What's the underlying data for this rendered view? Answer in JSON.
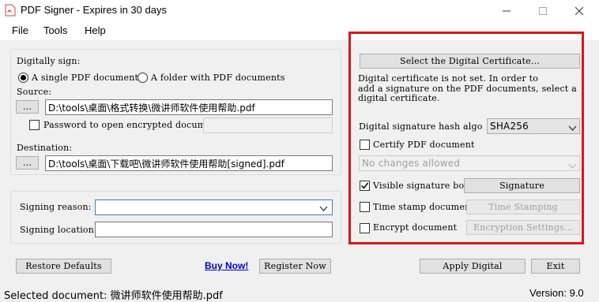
{
  "window": {
    "title": "PDF Signer - Expires in 30 days"
  },
  "menu": [
    "File",
    "Tools",
    "Help"
  ],
  "sign": {
    "label": "Digitally sign:",
    "option_single": "A single PDF document",
    "option_folder": "A folder with PDF documents",
    "selected": "single"
  },
  "source": {
    "label": "Source:",
    "browse_label": "...",
    "path": "D:\\tools\\桌面\\格式转换\\微讲师软件使用帮助.pdf",
    "password_label": "Password to open encrypted documen",
    "password_checked": false
  },
  "destination": {
    "label": "Destination:",
    "browse_label": "...",
    "path": "D:\\tools\\桌面\\下载吧\\微讲师软件使用帮助[signed].pdf"
  },
  "reason": {
    "signing_reason_label": "Signing reason:",
    "signing_reason_value": "",
    "signing_location_label": "Signing location",
    "signing_location_value": ""
  },
  "certificate": {
    "select_button": "Select the Digital Certificate...",
    "info_line1": "Digital certificate is not set. In order to",
    "info_line2": "add a signature on the PDF documents, select a",
    "info_line3": "digital certificate.",
    "hash_label": "Digital signature hash algo",
    "hash_value": "SHA256",
    "certify_label": "Certify PDF document",
    "certify_checked": false,
    "certify_option": "No changes allowed",
    "visible_label": "Visible signature box",
    "visible_checked": true,
    "signature_button": "Signature",
    "timestamp_label": "Time stamp document",
    "timestamp_checked": false,
    "timestamp_button": "Time Stamping",
    "encrypt_label": "Encrypt document",
    "encrypt_checked": false,
    "encrypt_button": "Encryption Settings..."
  },
  "actions": {
    "restore_defaults": "Restore Defaults",
    "buy_now": "Buy Now!",
    "register_now": "Register Now",
    "apply_digital": "Apply Digital",
    "exit": "Exit"
  },
  "status": {
    "selected_document": "Selected document: 微讲师软件使用帮助.pdf",
    "version": "Version: 9.0"
  },
  "colors": {
    "highlight_border": "#d6181f",
    "link": "#0000cc"
  }
}
